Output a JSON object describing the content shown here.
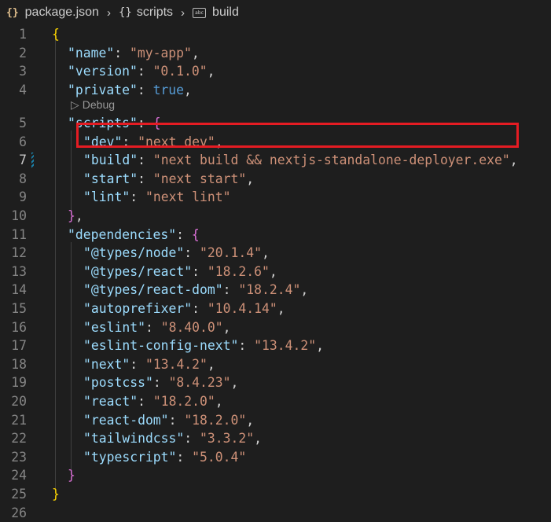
{
  "breadcrumb": {
    "file_icon_glyph": "{}",
    "file": "package.json",
    "section_icon_glyph": "{}",
    "section": "scripts",
    "leaf_icon_glyph": "abc",
    "leaf": "build"
  },
  "codelens": {
    "label": "Debug"
  },
  "lines": [
    {
      "num": "1",
      "active": false,
      "indent": 0,
      "tokens": [
        {
          "t": "{",
          "c": "br1"
        }
      ]
    },
    {
      "num": "2",
      "active": false,
      "indent": 1,
      "tokens": [
        {
          "t": "\"name\"",
          "c": "k"
        },
        {
          "t": ": ",
          "c": "p"
        },
        {
          "t": "\"my-app\"",
          "c": "s"
        },
        {
          "t": ",",
          "c": "p"
        }
      ]
    },
    {
      "num": "3",
      "active": false,
      "indent": 1,
      "tokens": [
        {
          "t": "\"version\"",
          "c": "k"
        },
        {
          "t": ": ",
          "c": "p"
        },
        {
          "t": "\"0.1.0\"",
          "c": "s"
        },
        {
          "t": ",",
          "c": "p"
        }
      ]
    },
    {
      "num": "4",
      "active": false,
      "indent": 1,
      "tokens": [
        {
          "t": "\"private\"",
          "c": "k"
        },
        {
          "t": ": ",
          "c": "p"
        },
        {
          "t": "true",
          "c": "b"
        },
        {
          "t": ",",
          "c": "p"
        }
      ]
    },
    {
      "num": "5",
      "active": false,
      "indent": 1,
      "tokens": [
        {
          "t": "\"scripts\"",
          "c": "k"
        },
        {
          "t": ": ",
          "c": "p"
        },
        {
          "t": "{",
          "c": "br2"
        }
      ]
    },
    {
      "num": "6",
      "active": false,
      "indent": 2,
      "tokens": [
        {
          "t": "\"dev\"",
          "c": "k"
        },
        {
          "t": ": ",
          "c": "p"
        },
        {
          "t": "\"next dev\"",
          "c": "s"
        },
        {
          "t": ",",
          "c": "p"
        }
      ]
    },
    {
      "num": "7",
      "active": true,
      "indent": 2,
      "tokens": [
        {
          "t": "\"build\"",
          "c": "k"
        },
        {
          "t": ": ",
          "c": "p"
        },
        {
          "t": "\"next build && nextjs-standalone-deployer.exe\"",
          "c": "s"
        },
        {
          "t": ",",
          "c": "p"
        }
      ]
    },
    {
      "num": "8",
      "active": false,
      "indent": 2,
      "tokens": [
        {
          "t": "\"start\"",
          "c": "k"
        },
        {
          "t": ": ",
          "c": "p"
        },
        {
          "t": "\"next start\"",
          "c": "s"
        },
        {
          "t": ",",
          "c": "p"
        }
      ]
    },
    {
      "num": "9",
      "active": false,
      "indent": 2,
      "tokens": [
        {
          "t": "\"lint\"",
          "c": "k"
        },
        {
          "t": ": ",
          "c": "p"
        },
        {
          "t": "\"next lint\"",
          "c": "s"
        }
      ]
    },
    {
      "num": "10",
      "active": false,
      "indent": 1,
      "tokens": [
        {
          "t": "}",
          "c": "br2"
        },
        {
          "t": ",",
          "c": "p"
        }
      ]
    },
    {
      "num": "11",
      "active": false,
      "indent": 1,
      "tokens": [
        {
          "t": "\"dependencies\"",
          "c": "k"
        },
        {
          "t": ": ",
          "c": "p"
        },
        {
          "t": "{",
          "c": "br2"
        }
      ]
    },
    {
      "num": "12",
      "active": false,
      "indent": 2,
      "tokens": [
        {
          "t": "\"@types/node\"",
          "c": "k"
        },
        {
          "t": ": ",
          "c": "p"
        },
        {
          "t": "\"20.1.4\"",
          "c": "s"
        },
        {
          "t": ",",
          "c": "p"
        }
      ]
    },
    {
      "num": "13",
      "active": false,
      "indent": 2,
      "tokens": [
        {
          "t": "\"@types/react\"",
          "c": "k"
        },
        {
          "t": ": ",
          "c": "p"
        },
        {
          "t": "\"18.2.6\"",
          "c": "s"
        },
        {
          "t": ",",
          "c": "p"
        }
      ]
    },
    {
      "num": "14",
      "active": false,
      "indent": 2,
      "tokens": [
        {
          "t": "\"@types/react-dom\"",
          "c": "k"
        },
        {
          "t": ": ",
          "c": "p"
        },
        {
          "t": "\"18.2.4\"",
          "c": "s"
        },
        {
          "t": ",",
          "c": "p"
        }
      ]
    },
    {
      "num": "15",
      "active": false,
      "indent": 2,
      "tokens": [
        {
          "t": "\"autoprefixer\"",
          "c": "k"
        },
        {
          "t": ": ",
          "c": "p"
        },
        {
          "t": "\"10.4.14\"",
          "c": "s"
        },
        {
          "t": ",",
          "c": "p"
        }
      ]
    },
    {
      "num": "16",
      "active": false,
      "indent": 2,
      "tokens": [
        {
          "t": "\"eslint\"",
          "c": "k"
        },
        {
          "t": ": ",
          "c": "p"
        },
        {
          "t": "\"8.40.0\"",
          "c": "s"
        },
        {
          "t": ",",
          "c": "p"
        }
      ]
    },
    {
      "num": "17",
      "active": false,
      "indent": 2,
      "tokens": [
        {
          "t": "\"eslint-config-next\"",
          "c": "k"
        },
        {
          "t": ": ",
          "c": "p"
        },
        {
          "t": "\"13.4.2\"",
          "c": "s"
        },
        {
          "t": ",",
          "c": "p"
        }
      ]
    },
    {
      "num": "18",
      "active": false,
      "indent": 2,
      "tokens": [
        {
          "t": "\"next\"",
          "c": "k"
        },
        {
          "t": ": ",
          "c": "p"
        },
        {
          "t": "\"13.4.2\"",
          "c": "s"
        },
        {
          "t": ",",
          "c": "p"
        }
      ]
    },
    {
      "num": "19",
      "active": false,
      "indent": 2,
      "tokens": [
        {
          "t": "\"postcss\"",
          "c": "k"
        },
        {
          "t": ": ",
          "c": "p"
        },
        {
          "t": "\"8.4.23\"",
          "c": "s"
        },
        {
          "t": ",",
          "c": "p"
        }
      ]
    },
    {
      "num": "20",
      "active": false,
      "indent": 2,
      "tokens": [
        {
          "t": "\"react\"",
          "c": "k"
        },
        {
          "t": ": ",
          "c": "p"
        },
        {
          "t": "\"18.2.0\"",
          "c": "s"
        },
        {
          "t": ",",
          "c": "p"
        }
      ]
    },
    {
      "num": "21",
      "active": false,
      "indent": 2,
      "tokens": [
        {
          "t": "\"react-dom\"",
          "c": "k"
        },
        {
          "t": ": ",
          "c": "p"
        },
        {
          "t": "\"18.2.0\"",
          "c": "s"
        },
        {
          "t": ",",
          "c": "p"
        }
      ]
    },
    {
      "num": "22",
      "active": false,
      "indent": 2,
      "tokens": [
        {
          "t": "\"tailwindcss\"",
          "c": "k"
        },
        {
          "t": ": ",
          "c": "p"
        },
        {
          "t": "\"3.3.2\"",
          "c": "s"
        },
        {
          "t": ",",
          "c": "p"
        }
      ]
    },
    {
      "num": "23",
      "active": false,
      "indent": 2,
      "tokens": [
        {
          "t": "\"typescript\"",
          "c": "k"
        },
        {
          "t": ": ",
          "c": "p"
        },
        {
          "t": "\"5.0.4\"",
          "c": "s"
        }
      ]
    },
    {
      "num": "24",
      "active": false,
      "indent": 1,
      "tokens": [
        {
          "t": "}",
          "c": "br2"
        }
      ]
    },
    {
      "num": "25",
      "active": false,
      "indent": 0,
      "tokens": [
        {
          "t": "}",
          "c": "br1"
        }
      ]
    },
    {
      "num": "26",
      "active": false,
      "indent": 0,
      "tokens": []
    }
  ]
}
